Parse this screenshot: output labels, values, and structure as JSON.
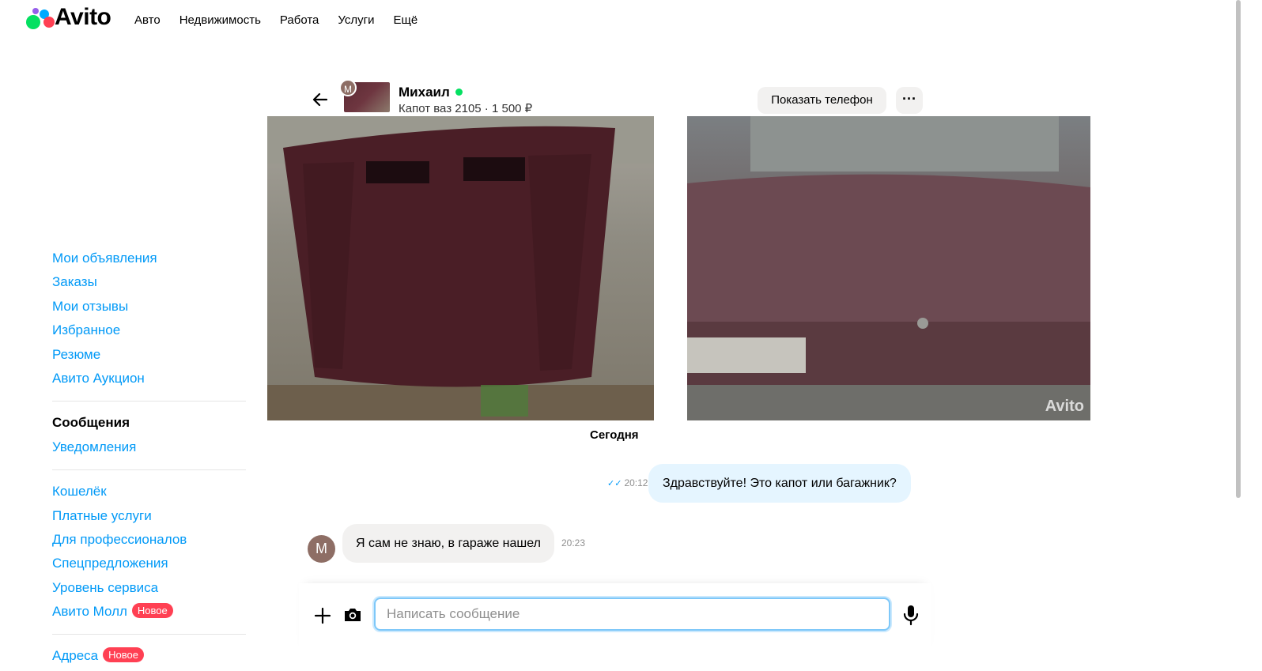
{
  "brand": {
    "name": "Avito"
  },
  "topnav": [
    "Авто",
    "Недвижимость",
    "Работа",
    "Услуги",
    "Ещё"
  ],
  "sidebar": {
    "group1": [
      "Мои объявления",
      "Заказы",
      "Мои отзывы",
      "Избранное",
      "Резюме",
      "Авито Аукцион"
    ],
    "group2": [
      {
        "label": "Сообщения",
        "active": true
      },
      {
        "label": "Уведомления",
        "active": false
      }
    ],
    "group3": [
      "Кошелёк",
      "Платные услуги",
      "Для профессионалов",
      "Спецпредложения",
      "Уровень сервиса"
    ],
    "mall": {
      "label": "Авито Молл",
      "badge": "Новое"
    },
    "addresses": {
      "label": "Адреса",
      "badge": "Новое"
    }
  },
  "chat": {
    "contact_name": "Михаил",
    "contact_initial": "М",
    "online": true,
    "item_title": "Капот ваз 2105 · 1 500 ₽",
    "show_phone": "Показать телефон",
    "more": "···",
    "photo_watermark": "Avito",
    "date_label": "Сегодня",
    "messages": [
      {
        "direction": "out",
        "text": "Здравствуйте! Это капот или багажник?",
        "time": "20:12",
        "read": true
      },
      {
        "direction": "in",
        "text": "Я сам не знаю, в гараже нашел",
        "time": "20:23"
      }
    ],
    "input_placeholder": "Написать сообщение"
  },
  "colors": {
    "link": "#0099f7",
    "badge": "#ff4053",
    "online": "#04e061",
    "out_bubble": "#e5f5ff",
    "in_bubble": "#f2f1f0"
  }
}
